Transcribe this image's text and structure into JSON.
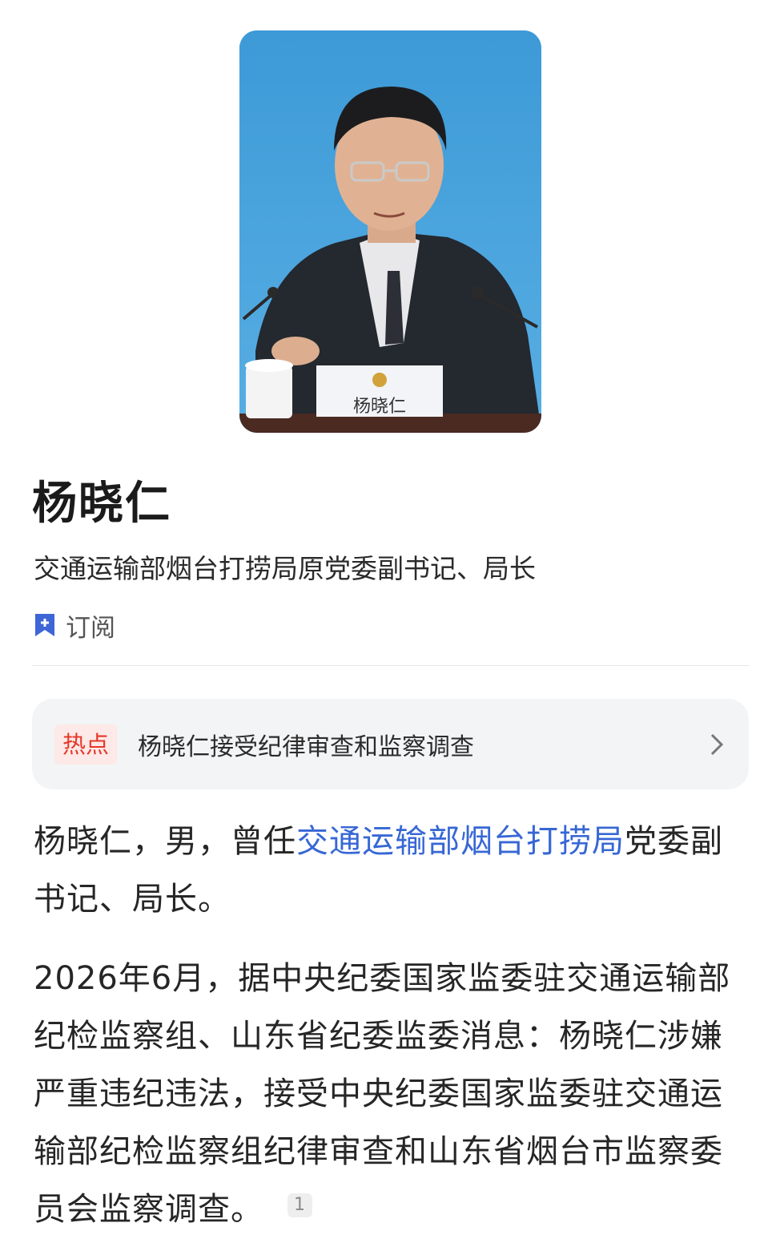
{
  "profile": {
    "name": "杨晓仁",
    "title": "交通运输部烟台打捞局原党委副书记、局长",
    "subscribe_label": "订阅",
    "nameplate_text": "杨晓仁"
  },
  "hot": {
    "badge": "热点",
    "text": "杨晓仁接受纪律审查和监察调查"
  },
  "intro": {
    "before_link": "杨晓仁，男，曾任",
    "link_text": "交通运输部烟台打捞局",
    "after_link": "党委副书记、局长。"
  },
  "news": {
    "text": "2026年6月，据中央纪委国家监委驻交通运输部纪检监察组、山东省纪委监委消息：杨晓仁涉嫌严重违纪违法，接受中央纪委国家监委驻交通运输部纪检监察组纪律审查和山东省烟台市监察委员会监察调查。",
    "citation": "1"
  },
  "colors": {
    "accent": "#3767d5",
    "hot_badge": "#e5372a",
    "subscribe_icon": "#3e66d6"
  }
}
